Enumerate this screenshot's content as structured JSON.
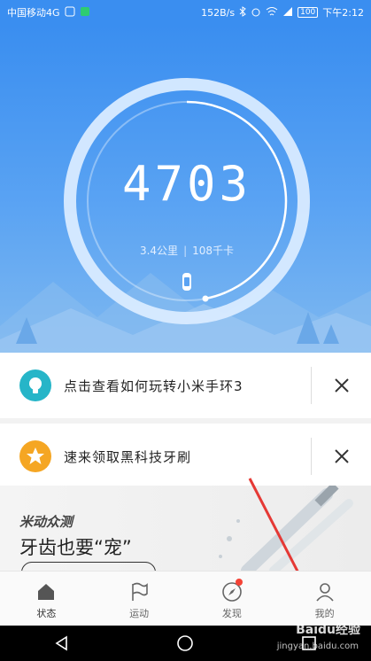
{
  "status_bar": {
    "carrier": "中国移动4G",
    "speed": "152B/s",
    "battery": "100",
    "time": "下午2:12"
  },
  "summary": {
    "steps": "4703",
    "distance": "3.4公里",
    "calories": "108千卡",
    "goal_progress": 0.47,
    "device_icon": "band-icon"
  },
  "cards": [
    {
      "icon": "bulb-icon",
      "icon_color": "#26b5c8",
      "title": "点击查看如何玩转小米手环3"
    },
    {
      "icon": "star-icon",
      "icon_color": "#f5a623",
      "title": "速来领取黑科技牙刷"
    }
  ],
  "banner": {
    "brand": "米动众测",
    "headline": "牙齿也要“宠”"
  },
  "tabs": [
    {
      "label": "状态",
      "icon": "home-icon"
    },
    {
      "label": "运动",
      "icon": "flag-icon"
    },
    {
      "label": "发现",
      "icon": "compass-icon"
    },
    {
      "label": "我的",
      "icon": "profile-icon"
    }
  ],
  "watermark": {
    "main": "Baidu经验",
    "url": "jingyan.baidu.com"
  },
  "colors": {
    "primary": "#3a8ef0",
    "badge": "#f44336"
  }
}
